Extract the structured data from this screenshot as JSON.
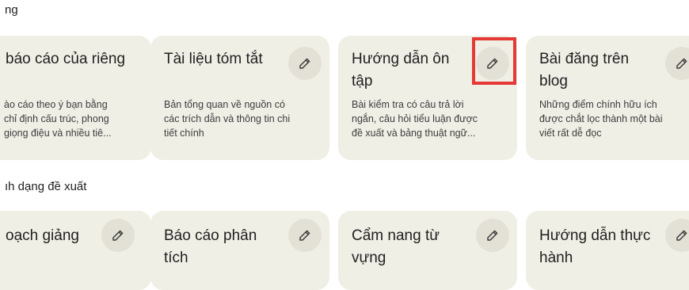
{
  "sections": {
    "top_label": "ng",
    "bottom_label": "ıh dạng đề xuất"
  },
  "cards_row1": [
    {
      "title": "báo cáo của riêng",
      "desc": "ào cáo theo ý bạn bằng\nchỉ định cấu trúc, phong\ngiọng điệu và nhiều tiê...",
      "icon": "pencil-icon"
    },
    {
      "title": "Tài liệu tóm tắt",
      "desc": "Bản tổng quan về nguồn có\ncác trích dẫn và thông tin chi\ntiết chính",
      "icon": "pencil-icon"
    },
    {
      "title": "Hướng dẫn ôn\ntập",
      "desc": "Bài kiểm tra có câu trả lời\nngắn, câu hỏi tiểu luận được\nđề xuất và bảng thuật ngữ...",
      "icon": "pencil-icon"
    },
    {
      "title": "Bài đăng trên\nblog",
      "desc": "Những điểm chính hữu ích\nđược chắt lọc thành một bài\nviết rất dễ đọc",
      "icon": "pencil-icon"
    }
  ],
  "cards_row2": [
    {
      "title": "oạch giảng",
      "icon": "pencil-icon"
    },
    {
      "title": "Báo cáo phân\ntích",
      "icon": "pencil-icon"
    },
    {
      "title": "Cẩm nang từ\nvựng",
      "icon": "pencil-icon"
    },
    {
      "title": "Hướng dẫn thực\nhành",
      "icon": "pencil-icon"
    }
  ],
  "colors": {
    "card_bg": "#f0efe6",
    "edit_button_bg": "#e3e1d6",
    "highlight": "#e53935"
  }
}
